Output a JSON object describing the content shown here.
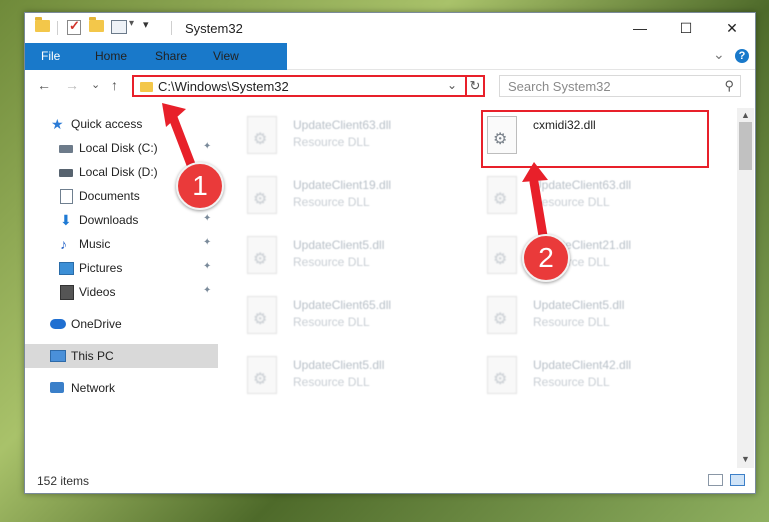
{
  "window": {
    "title": "System32",
    "controls": {
      "minimize": "—",
      "maximize": "☐",
      "close": "✕"
    }
  },
  "ribbon": {
    "tabs": [
      "File",
      "Home",
      "Share",
      "View"
    ],
    "expand_icon": "⌄",
    "help_icon": "?"
  },
  "navigation": {
    "back_icon": "←",
    "forward_icon": "→",
    "recent_icon": "⌄",
    "up_icon": "↑",
    "address": "C:\\Windows\\System32",
    "address_dropdown": "⌄",
    "refresh_icon": "↻",
    "search_placeholder": "Search System32",
    "search_icon": "⚲"
  },
  "sidebar": {
    "items": [
      {
        "label": "Quick access",
        "icon": "star-icon",
        "pinned": false
      },
      {
        "label": "Local Disk (C:)",
        "icon": "drive-icon",
        "pinned": true
      },
      {
        "label": "Local Disk (D:)",
        "icon": "drive-icon",
        "pinned": false
      },
      {
        "label": "Documents",
        "icon": "documents-icon",
        "pinned": false
      },
      {
        "label": "Downloads",
        "icon": "download-icon",
        "pinned": true
      },
      {
        "label": "Music",
        "icon": "music-icon",
        "pinned": true
      },
      {
        "label": "Pictures",
        "icon": "pictures-icon",
        "pinned": true
      },
      {
        "label": "Videos",
        "icon": "videos-icon",
        "pinned": true
      },
      {
        "label": "OneDrive",
        "icon": "cloud-icon",
        "pinned": false
      },
      {
        "label": "This PC",
        "icon": "computer-icon",
        "pinned": false,
        "selected": true
      },
      {
        "label": "Network",
        "icon": "network-icon",
        "pinned": false
      }
    ],
    "pin_glyph": "📌"
  },
  "files": {
    "left_column": [
      {
        "name": "UpdateClient63.dll",
        "type": "Resource DLL"
      },
      {
        "name": "UpdateClient19.dll",
        "type": "Resource DLL"
      },
      {
        "name": "UpdateClient5.dll",
        "type": "Resource DLL"
      },
      {
        "name": "UpdateClient65.dll",
        "type": "Resource DLL"
      },
      {
        "name": "UpdateClient5.dll",
        "type": "Resource DLL"
      }
    ],
    "right_column": [
      {
        "name": "cxmidi32.dll",
        "type": ""
      },
      {
        "name": "UpdateClient63.dll",
        "type": "Resource DLL"
      },
      {
        "name": "UpdateClient21.dll",
        "type": "Resource DLL"
      },
      {
        "name": "UpdateClient5.dll",
        "type": "Resource DLL"
      },
      {
        "name": "UpdateClient42.dll",
        "type": "Resource DLL"
      }
    ]
  },
  "status": {
    "item_count": "152 items"
  },
  "annotations": {
    "step1": "1",
    "step2": "2",
    "color": "#e8202a"
  }
}
